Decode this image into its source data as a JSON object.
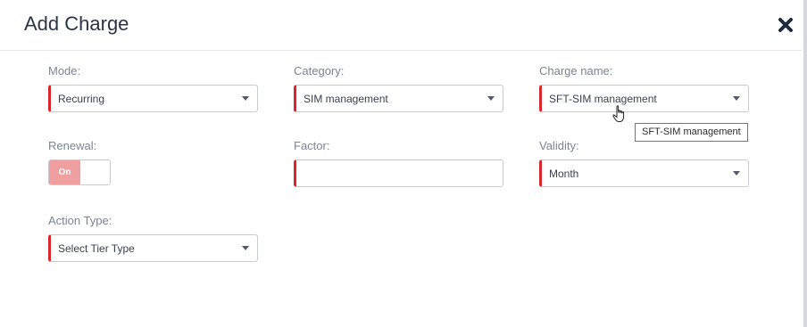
{
  "modal": {
    "title": "Add Charge",
    "close_icon": "close-x-icon"
  },
  "form": {
    "mode": {
      "label": "Mode:",
      "value": "Recurring"
    },
    "category": {
      "label": "Category:",
      "value": "SIM management"
    },
    "charge_name": {
      "label": "Charge name:",
      "value": "SFT-SIM management"
    },
    "renewal": {
      "label": "Renewal:",
      "toggle_label": "On",
      "state": "on"
    },
    "factor": {
      "label": "Factor:",
      "value": ""
    },
    "validity": {
      "label": "Validity:",
      "value": "Month"
    },
    "action_type": {
      "label": "Action Type:",
      "value": "Select Tier Type"
    }
  },
  "tooltip": {
    "text": "SFT-SIM management"
  },
  "colors": {
    "required_accent": "#d9262c",
    "toggle_on_bg": "#ef9f9f",
    "title_color": "#2b3445",
    "label_color": "#7b8595"
  },
  "cursor_icon": "hand-pointer-icon"
}
